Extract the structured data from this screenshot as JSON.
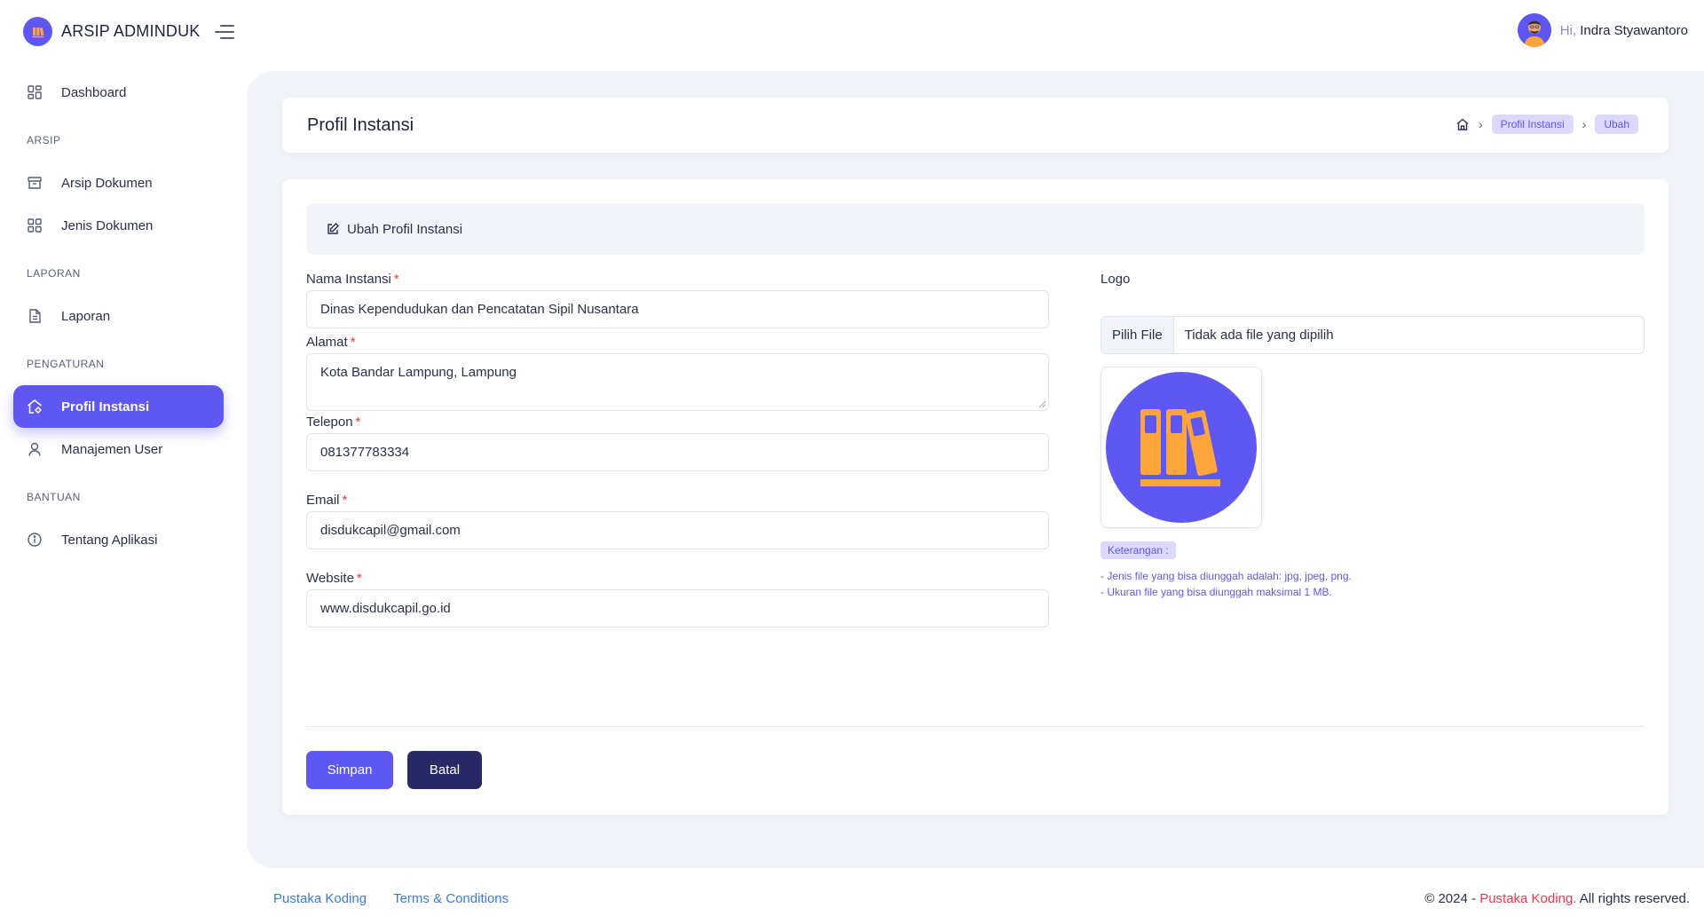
{
  "app": {
    "name": "ARSIP ADMINDUK"
  },
  "user": {
    "greeting": "Hi,",
    "name": "Indra Styawantoro"
  },
  "sidebar": {
    "items": [
      {
        "label": "Dashboard",
        "icon": "grid-icon"
      },
      {
        "section": "ARSIP"
      },
      {
        "label": "Arsip Dokumen",
        "icon": "archive-icon"
      },
      {
        "label": "Jenis Dokumen",
        "icon": "grid-icon"
      },
      {
        "section": "LAPORAN"
      },
      {
        "label": "Laporan",
        "icon": "file-text-icon"
      },
      {
        "section": "PENGATURAN"
      },
      {
        "label": "Profil Instansi",
        "icon": "home-gear-icon",
        "active": true
      },
      {
        "label": "Manajemen User",
        "icon": "user-icon"
      },
      {
        "section": "BANTUAN"
      },
      {
        "label": "Tentang Aplikasi",
        "icon": "info-icon"
      }
    ]
  },
  "page": {
    "title": "Profil Instansi",
    "breadcrumb": [
      "Profil Instansi",
      "Ubah"
    ]
  },
  "form": {
    "header": "Ubah Profil Instansi",
    "nama_label": "Nama Instansi",
    "nama_value": "Dinas Kependudukan dan Pencatatan Sipil Nusantara",
    "alamat_label": "Alamat",
    "alamat_value": "Kota Bandar Lampung, Lampung",
    "telepon_label": "Telepon",
    "telepon_value": "081377783334",
    "email_label": "Email",
    "email_value": "disdukcapil@gmail.com",
    "website_label": "Website",
    "website_value": "www.disdukcapil.go.id",
    "required_mark": "*",
    "logo_label": "Logo",
    "file_button": "Pilih File",
    "file_status": "Tidak ada file yang dipilih",
    "keterangan_label": "Keterangan :",
    "note_1": "- Jenis file yang bisa diunggah adalah: jpg, jpeg, png.",
    "note_2": "- Ukuran file yang bisa diunggah maksimal 1 MB.",
    "save_button": "Simpan",
    "cancel_button": "Batal"
  },
  "footer": {
    "link_1": "Pustaka Koding",
    "link_2": "Terms & Conditions",
    "copy_prefix": "© 2024 -",
    "copy_brand": "Pustaka Koding.",
    "copy_suffix": "All rights reserved."
  },
  "colors": {
    "accent": "#5f57f2",
    "dark_button": "#2a2968",
    "logo_books": "#ffa53b",
    "required": "#e53935",
    "footer_link": "#3c7ad6"
  }
}
